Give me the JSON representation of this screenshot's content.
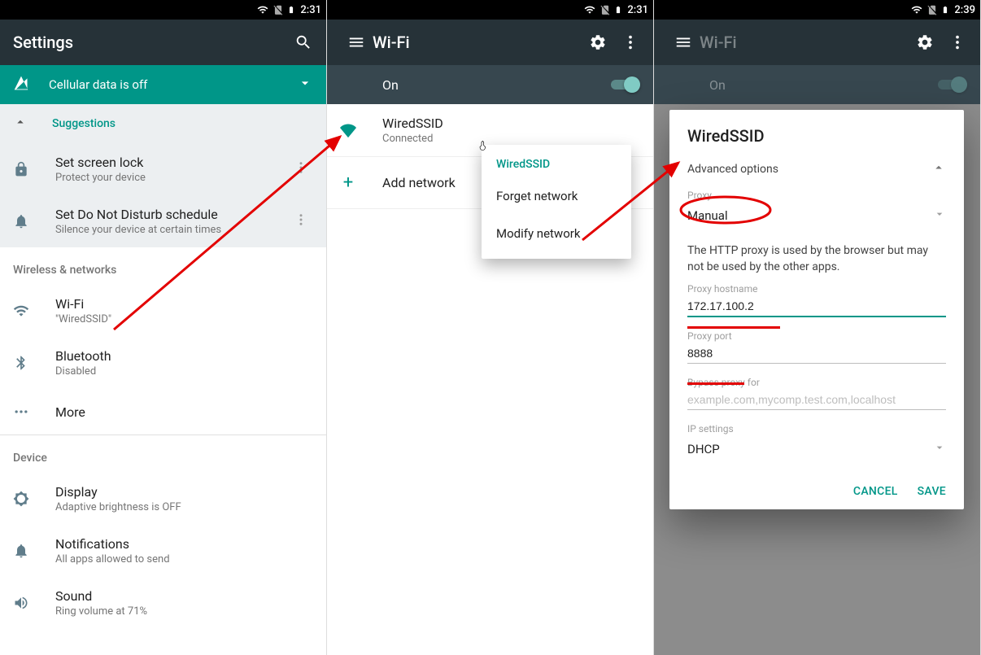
{
  "statusbar": {
    "time_1": "2:31",
    "time_2": "2:31",
    "time_3": "2:39"
  },
  "panel1": {
    "toolbar_title": "Settings",
    "banner_text": "Cellular data is off",
    "suggestions_label": "Suggestions",
    "sugg1_title": "Set screen lock",
    "sugg1_sub": "Protect your device",
    "sugg2_title": "Set Do Not Disturb schedule",
    "sugg2_sub": "Silence your device at certain times",
    "sect_wireless": "Wireless & networks",
    "wifi_title": "Wi-Fi",
    "wifi_sub": "\"WiredSSID\"",
    "bt_title": "Bluetooth",
    "bt_sub": "Disabled",
    "more_title": "More",
    "sect_device": "Device",
    "display_title": "Display",
    "display_sub": "Adaptive brightness is OFF",
    "notif_title": "Notifications",
    "notif_sub": "All apps allowed to send",
    "sound_title": "Sound",
    "sound_sub": "Ring volume at 71%"
  },
  "panel2": {
    "toolbar_title": "Wi-Fi",
    "on_label": "On",
    "ssid": "WiredSSID",
    "ssid_sub": "Connected",
    "add_label": "Add network",
    "popup_title": "WiredSSID",
    "popup_forget": "Forget network",
    "popup_modify": "Modify network"
  },
  "panel3": {
    "toolbar_title": "Wi-Fi",
    "on_label": "On",
    "dialog_title": "WiredSSID",
    "adv_label": "Advanced options",
    "proxy_label": "Proxy",
    "proxy_value": "Manual",
    "proxy_note": "The HTTP proxy is used by the browser but may not be used by the other apps.",
    "host_label": "Proxy hostname",
    "host_value": "172.17.100.2",
    "port_label": "Proxy port",
    "port_value": "8888",
    "bypass_label": "Bypass proxy for",
    "bypass_placeholder": "example.com,mycomp.test.com,localhost",
    "ip_label": "IP settings",
    "ip_value": "DHCP",
    "cancel": "CANCEL",
    "save": "SAVE"
  }
}
